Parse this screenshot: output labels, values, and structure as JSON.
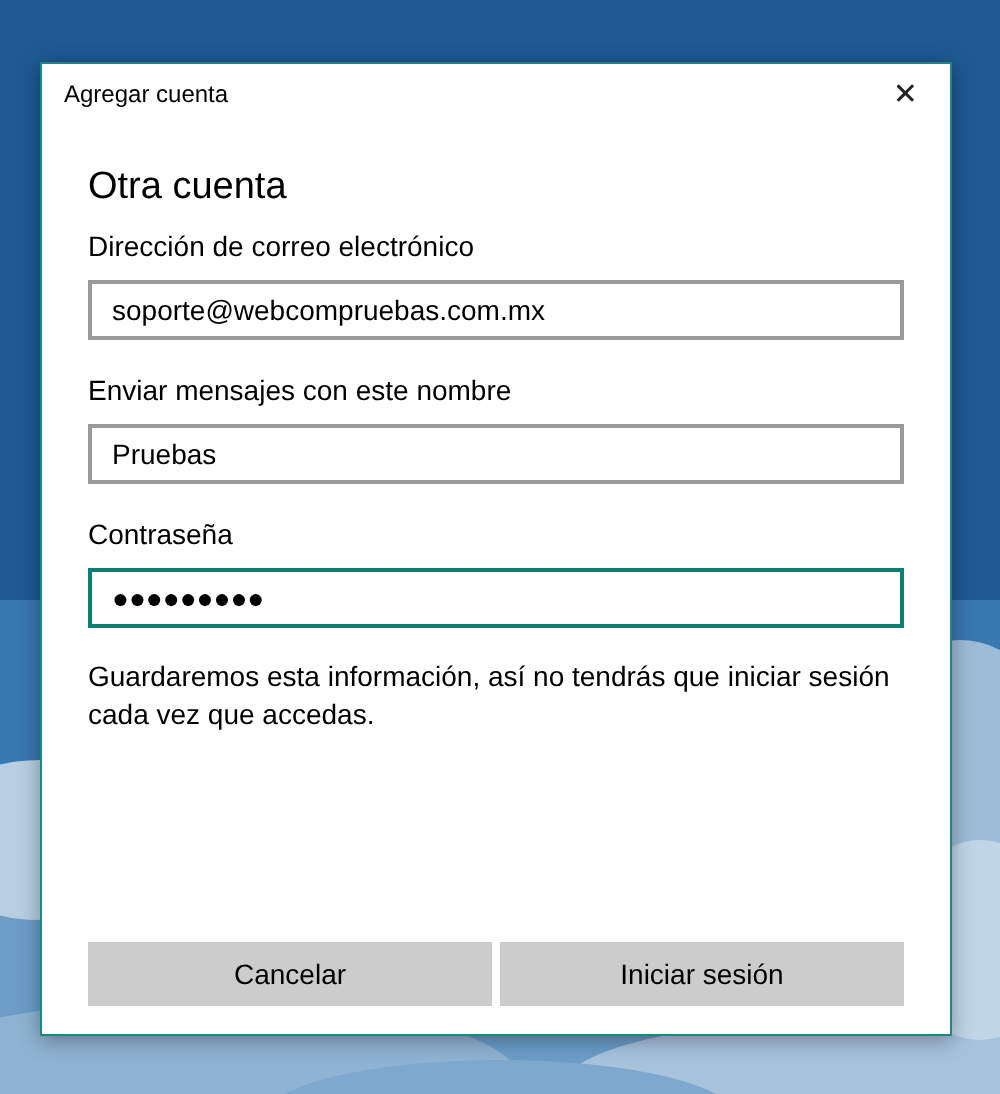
{
  "window": {
    "title": "Agregar cuenta",
    "close": "✕"
  },
  "heading": "Otra cuenta",
  "fields": [
    {
      "label": "Dirección de correo electrónico",
      "value": "soporte@webcompruebas.com.mx",
      "focused": false
    },
    {
      "label": "Enviar mensajes con este nombre",
      "value": "Pruebas",
      "focused": false
    },
    {
      "label": "Contraseña",
      "value": "●●●●●●●●●",
      "focused": true
    }
  ],
  "info": "Guardaremos esta información, así no tendrás que iniciar sesión cada vez que accedas.",
  "buttons": [
    "Cancelar",
    "Iniciar sesión"
  ]
}
